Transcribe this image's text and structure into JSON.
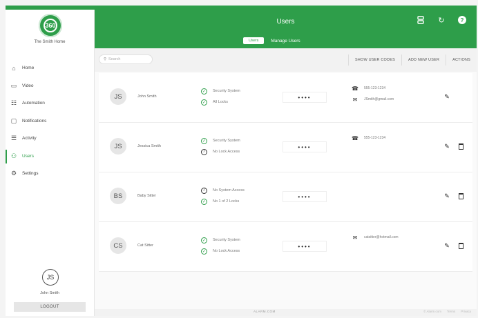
{
  "sidebar": {
    "logo_text": "360",
    "home_name": "The Smith Home",
    "nav": [
      {
        "label": "Home",
        "icon": "home-icon",
        "glyph": "⌂"
      },
      {
        "label": "Video",
        "icon": "video-icon",
        "glyph": "▭"
      },
      {
        "label": "Automation",
        "icon": "automation-icon",
        "glyph": "☷"
      },
      {
        "label": "Notifications",
        "icon": "notifications-icon",
        "glyph": "▢"
      },
      {
        "label": "Activity",
        "icon": "activity-icon",
        "glyph": "☰"
      },
      {
        "label": "Users",
        "icon": "users-icon",
        "glyph": "⚇",
        "active": true
      },
      {
        "label": "Settings",
        "icon": "settings-icon",
        "glyph": "⚙"
      }
    ],
    "user_initials": "JS",
    "user_name": "John Smith",
    "logout_label": "LOGOUT"
  },
  "header": {
    "title": "Users",
    "tab_users": "Users",
    "tab_manage": "Manage Users"
  },
  "toolbar": {
    "search_placeholder": "Search",
    "show_codes": "SHOW USER CODES",
    "add_user": "ADD NEW USER",
    "actions": "ACTIONS"
  },
  "users": [
    {
      "initials": "JS",
      "name": "John Smith",
      "access": [
        {
          "text": "Security System",
          "status": "ok"
        },
        {
          "text": "All Locks",
          "status": "ok"
        }
      ],
      "pin": "••••",
      "contacts": [
        {
          "type": "phone",
          "text": "555-123-1234"
        },
        {
          "type": "email",
          "text": "JSmith@gmail.com"
        }
      ],
      "can_delete": false
    },
    {
      "initials": "JS",
      "name": "Jessica Smith",
      "access": [
        {
          "text": "Security System",
          "status": "ok"
        },
        {
          "text": "No Lock Access",
          "status": "no"
        }
      ],
      "pin": "••••",
      "contacts": [
        {
          "type": "phone",
          "text": "555-123-1234"
        }
      ],
      "can_delete": true
    },
    {
      "initials": "BS",
      "name": "Baby Sitter",
      "access": [
        {
          "text": "No System Access",
          "status": "no"
        },
        {
          "text": "No 1 of 2 Locks",
          "status": "ok"
        }
      ],
      "pin": "••••",
      "contacts": [],
      "can_delete": true
    },
    {
      "initials": "CS",
      "name": "Cat Sitter",
      "access": [
        {
          "text": "Security System",
          "status": "ok"
        },
        {
          "text": "No Lock Access",
          "status": "ok"
        }
      ],
      "pin": "••••",
      "contacts": [
        {
          "type": "email",
          "text": "catsitter@hotmail.com"
        }
      ],
      "can_delete": true
    }
  ],
  "footer": {
    "logo": "ALARM.COM",
    "links": [
      "© Alarm.com",
      "Terms",
      "Privacy"
    ]
  },
  "colors": {
    "brand": "#2e9e4a"
  }
}
